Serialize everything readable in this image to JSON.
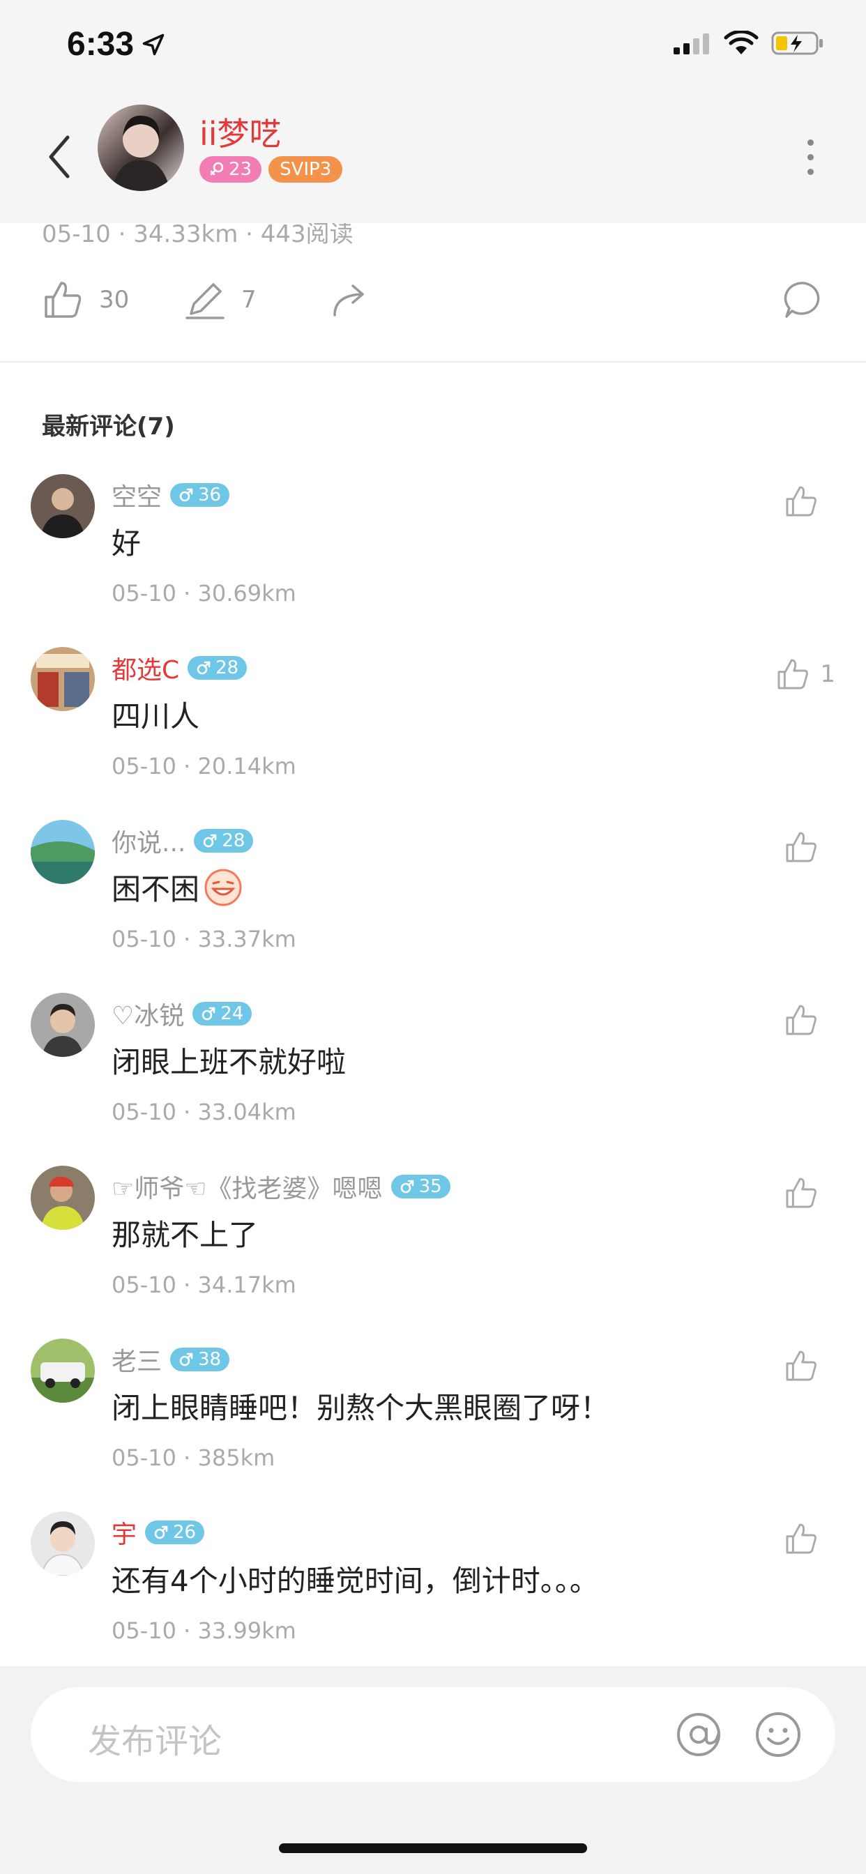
{
  "status_bar": {
    "time": "6:33"
  },
  "header": {
    "name": "ii梦呓",
    "age": "23",
    "vip": "SVIP3"
  },
  "post": {
    "meta": "05-10 · 34.33km · 443阅读",
    "likes": "30",
    "comments_count": "7"
  },
  "comments_section": {
    "title": "最新评论(7)",
    "items": [
      {
        "name": "空空",
        "age": "36",
        "text": "好",
        "meta": "05-10 · 30.69km",
        "likes": "",
        "name_color": "gray"
      },
      {
        "name": "都选C",
        "age": "28",
        "text": "四川人",
        "meta": "05-10 · 20.14km",
        "likes": "1",
        "name_color": "red"
      },
      {
        "name": "你说...",
        "age": "28",
        "text": "困不困",
        "meta": "05-10 · 33.37km",
        "likes": "",
        "name_color": "gray",
        "emoji": "grin-emoji"
      },
      {
        "name": "♡冰锐",
        "age": "24",
        "text": "闭眼上班不就好啦",
        "meta": "05-10 · 33.04km",
        "likes": "",
        "name_color": "gray"
      },
      {
        "name": "☞师爷☜《找老婆》嗯嗯",
        "age": "35",
        "text": "那就不上了",
        "meta": "05-10 · 34.17km",
        "likes": "",
        "name_color": "gray"
      },
      {
        "name": "老三",
        "age": "38",
        "text": "闭上眼睛睡吧！别熬个大黑眼圈了呀！",
        "meta": "05-10 · 385km",
        "likes": "",
        "name_color": "gray"
      },
      {
        "name": "宇",
        "age": "26",
        "text": "还有4个小时的睡觉时间，倒计时。。。",
        "meta": "05-10 · 33.99km",
        "likes": "",
        "name_color": "red"
      }
    ]
  },
  "input": {
    "placeholder": "发布评论"
  },
  "colors": {
    "red_name": "#e23a3a",
    "male_badge": "#6fc7e8",
    "female_badge": "#f27db4",
    "vip_badge": "#f3924a"
  }
}
